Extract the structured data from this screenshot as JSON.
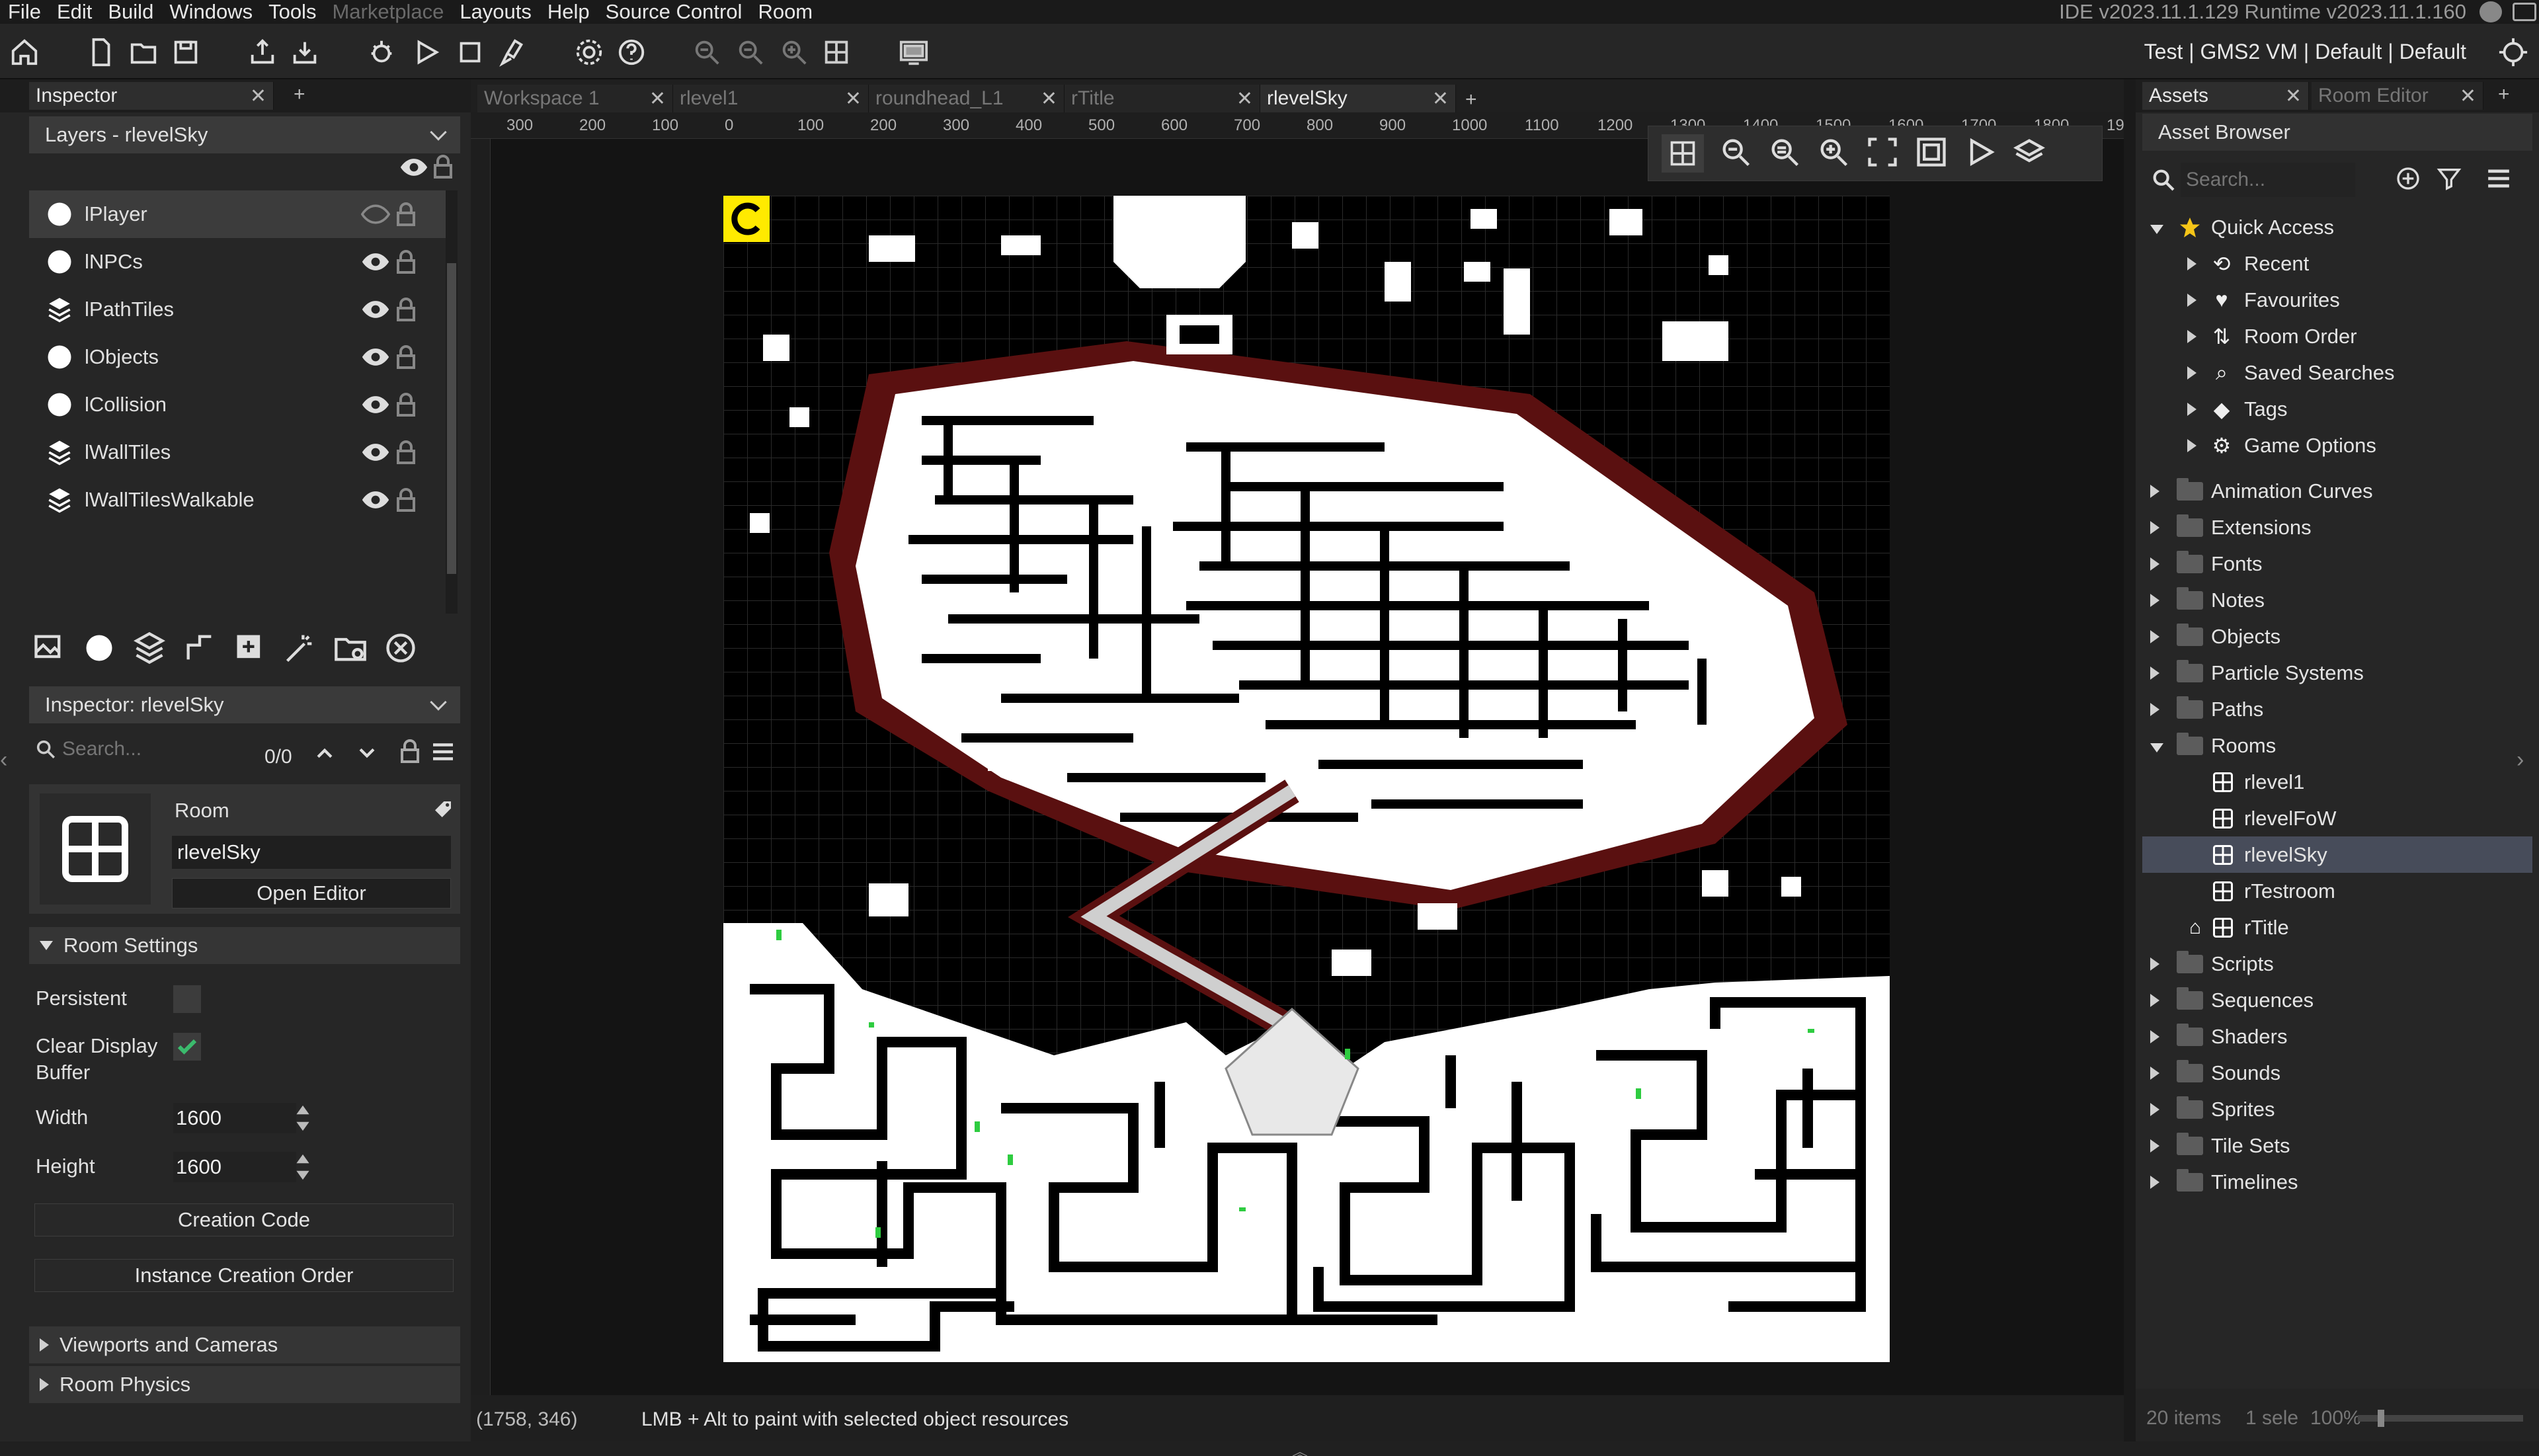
{
  "menu": {
    "items": [
      "File",
      "Edit",
      "Build",
      "Windows",
      "Tools",
      "Marketplace",
      "Layouts",
      "Help",
      "Source Control",
      "Room"
    ],
    "disabled": [
      "Marketplace"
    ]
  },
  "ide_version": "IDE v2023.11.1.129  Runtime v2023.11.1.160",
  "target": "Test | GMS2 VM | Default | Default",
  "inspector": {
    "tab_label": "Inspector",
    "layers_header": "Layers - rlevelSky",
    "layers": [
      {
        "name": "lPlayer",
        "type": "instance",
        "selected": true,
        "visible": false
      },
      {
        "name": "lNPCs",
        "type": "instance"
      },
      {
        "name": "lPathTiles",
        "type": "tile"
      },
      {
        "name": "lObjects",
        "type": "instance"
      },
      {
        "name": "lCollision",
        "type": "instance"
      },
      {
        "name": "lWallTiles",
        "type": "tile"
      },
      {
        "name": "lWallTilesWalkable",
        "type": "tile"
      }
    ],
    "inspector_header": "Inspector: rlevelSky",
    "search_placeholder": "Search...",
    "search_count": "0/0",
    "resource_type": "Room",
    "resource_name": "rlevelSky",
    "open_editor": "Open Editor",
    "room_settings": "Room Settings",
    "persistent_label": "Persistent",
    "clear_display_label": "Clear Display\nBuffer",
    "clear_display_checked": true,
    "width_label": "Width",
    "width_value": "1600",
    "height_label": "Height",
    "height_value": "1600",
    "creation_code": "Creation Code",
    "instance_order": "Instance Creation Order",
    "viewports": "Viewports and Cameras",
    "physics": "Room Physics"
  },
  "workspace_tabs": [
    {
      "label": "Workspace 1",
      "active": false
    },
    {
      "label": "rlevel1",
      "active": false
    },
    {
      "label": "roundhead_L1",
      "active": false
    },
    {
      "label": "rTitle",
      "active": false
    },
    {
      "label": "rlevelSky",
      "active": true
    }
  ],
  "ruler": {
    "top": [
      "300",
      "200",
      "100",
      "0",
      "100",
      "200",
      "300",
      "400",
      "500",
      "600",
      "700",
      "800",
      "900",
      "1000",
      "1100",
      "1200",
      "1300",
      "1400",
      "1500",
      "1600",
      "1700",
      "1800",
      "19"
    ]
  },
  "canvas": {
    "coords": "(1758, 346)",
    "status": "LMB + Alt to paint with selected object resources"
  },
  "assets": {
    "tab_label": "Assets",
    "tab2_label": "Room Editor",
    "browser_title": "Asset Browser",
    "search_placeholder": "Search...",
    "quick_access": "Quick Access",
    "quick_items": [
      "Recent",
      "Favourites",
      "Room Order",
      "Saved Searches",
      "Tags",
      "Game Options"
    ],
    "folders_top": [
      "Animation Curves",
      "Extensions",
      "Fonts",
      "Notes",
      "Objects",
      "Particle Systems",
      "Paths"
    ],
    "rooms_label": "Rooms",
    "rooms": [
      {
        "name": "rlevel1",
        "selected": false,
        "home": false
      },
      {
        "name": "rlevelFoW",
        "selected": false,
        "home": false
      },
      {
        "name": "rlevelSky",
        "selected": true,
        "home": false
      },
      {
        "name": "rTestroom",
        "selected": false,
        "home": false
      },
      {
        "name": "rTitle",
        "selected": false,
        "home": true
      }
    ],
    "folders_bottom": [
      "Scripts",
      "Sequences",
      "Shaders",
      "Sounds",
      "Sprites",
      "Tile Sets",
      "Timelines"
    ],
    "footer_count": "20 items",
    "footer_sel": "1 sele",
    "footer_zoom": "100%"
  }
}
